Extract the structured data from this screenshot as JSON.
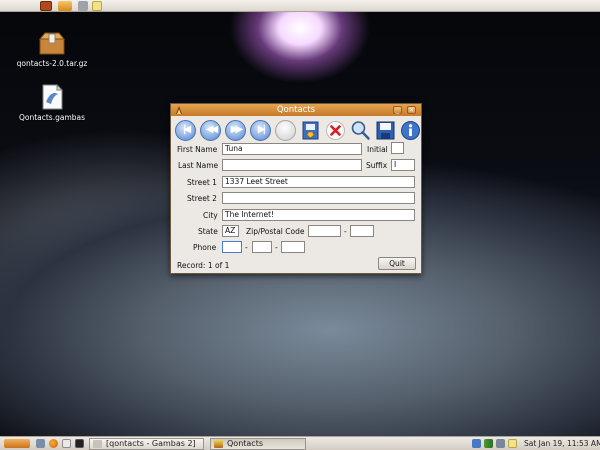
{
  "desktop": {
    "icons": [
      {
        "label": "qontacts-2.0.tar.gz",
        "icon": "archive-icon"
      },
      {
        "label": "Qontacts.gambas",
        "icon": "gambas-file-icon"
      }
    ]
  },
  "top_panel": {
    "launchers": [
      "app-launcher-icon",
      "menu-icon",
      "applet-icon",
      "notes-icon"
    ]
  },
  "taskbar": {
    "tasks": [
      {
        "label": "[qontacts - Gambas 2]",
        "active": false
      },
      {
        "label": "Qontacts",
        "active": true
      }
    ],
    "clock": "Sat Jan 19, 11:53 AM"
  },
  "window": {
    "title": "Qontacts",
    "minimize": "_",
    "close": "×",
    "toolbar": [
      "first-record-icon",
      "previous-record-icon",
      "next-record-icon",
      "last-record-icon",
      "blank-icon",
      "new-record-icon",
      "delete-icon",
      "search-icon",
      "save-icon",
      "info-icon"
    ],
    "form": {
      "first_name_label": "First Name",
      "first_name": "Tuna",
      "initial_label": "Initial",
      "initial": "",
      "last_name_label": "Last Name",
      "last_name": "",
      "suffix_label": "Suffix",
      "suffix": "I",
      "street1_label": "Street 1",
      "street1": "1337 Leet Street",
      "street2_label": "Street 2",
      "street2": "",
      "city_label": "City",
      "city": "The Internet!",
      "state_label": "State",
      "state": "AZ",
      "zip_label": "Zip/Postal Code",
      "zip1": "",
      "zip_sep": "-",
      "zip2": "",
      "phone_label": "Phone",
      "phone1": "",
      "phone_sep1": "-",
      "phone2": "",
      "phone_sep2": "-",
      "phone3": ""
    },
    "record_status": "Record: 1 of 1",
    "quit_label": "Quit"
  }
}
